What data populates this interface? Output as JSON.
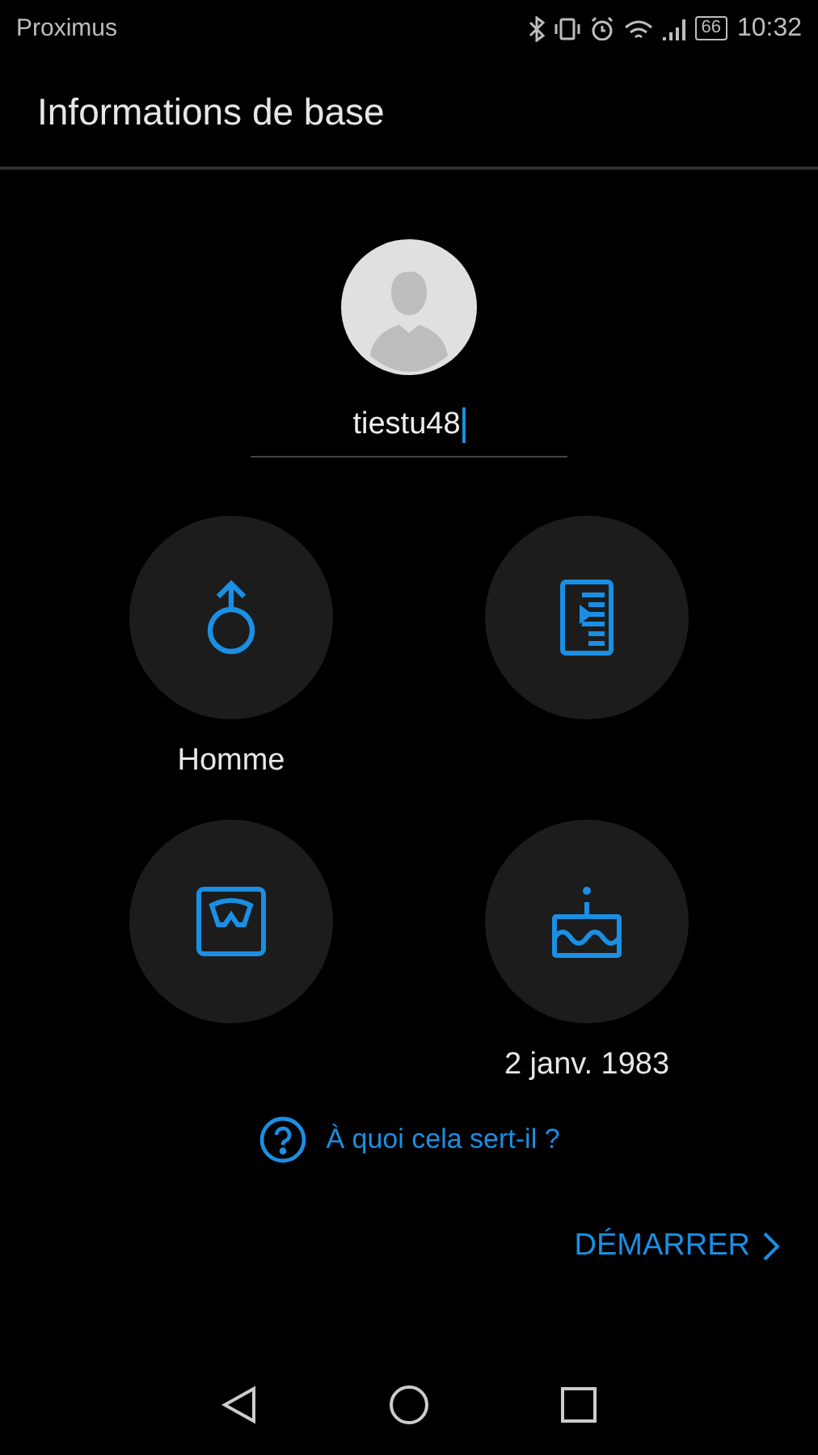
{
  "status_bar": {
    "carrier": "Proximus",
    "battery": "66",
    "time": "10:32"
  },
  "title": "Informations de base",
  "profile": {
    "username": "tiestu48",
    "focused": true
  },
  "tiles": [
    {
      "kind": "gender",
      "label": "Homme"
    },
    {
      "kind": "height"
    },
    {
      "kind": "weight"
    },
    {
      "kind": "birthday",
      "label": "2 janv. 1983"
    }
  ],
  "help_link": "À quoi cela sert-il ?",
  "start_button": "DÉMARRER"
}
